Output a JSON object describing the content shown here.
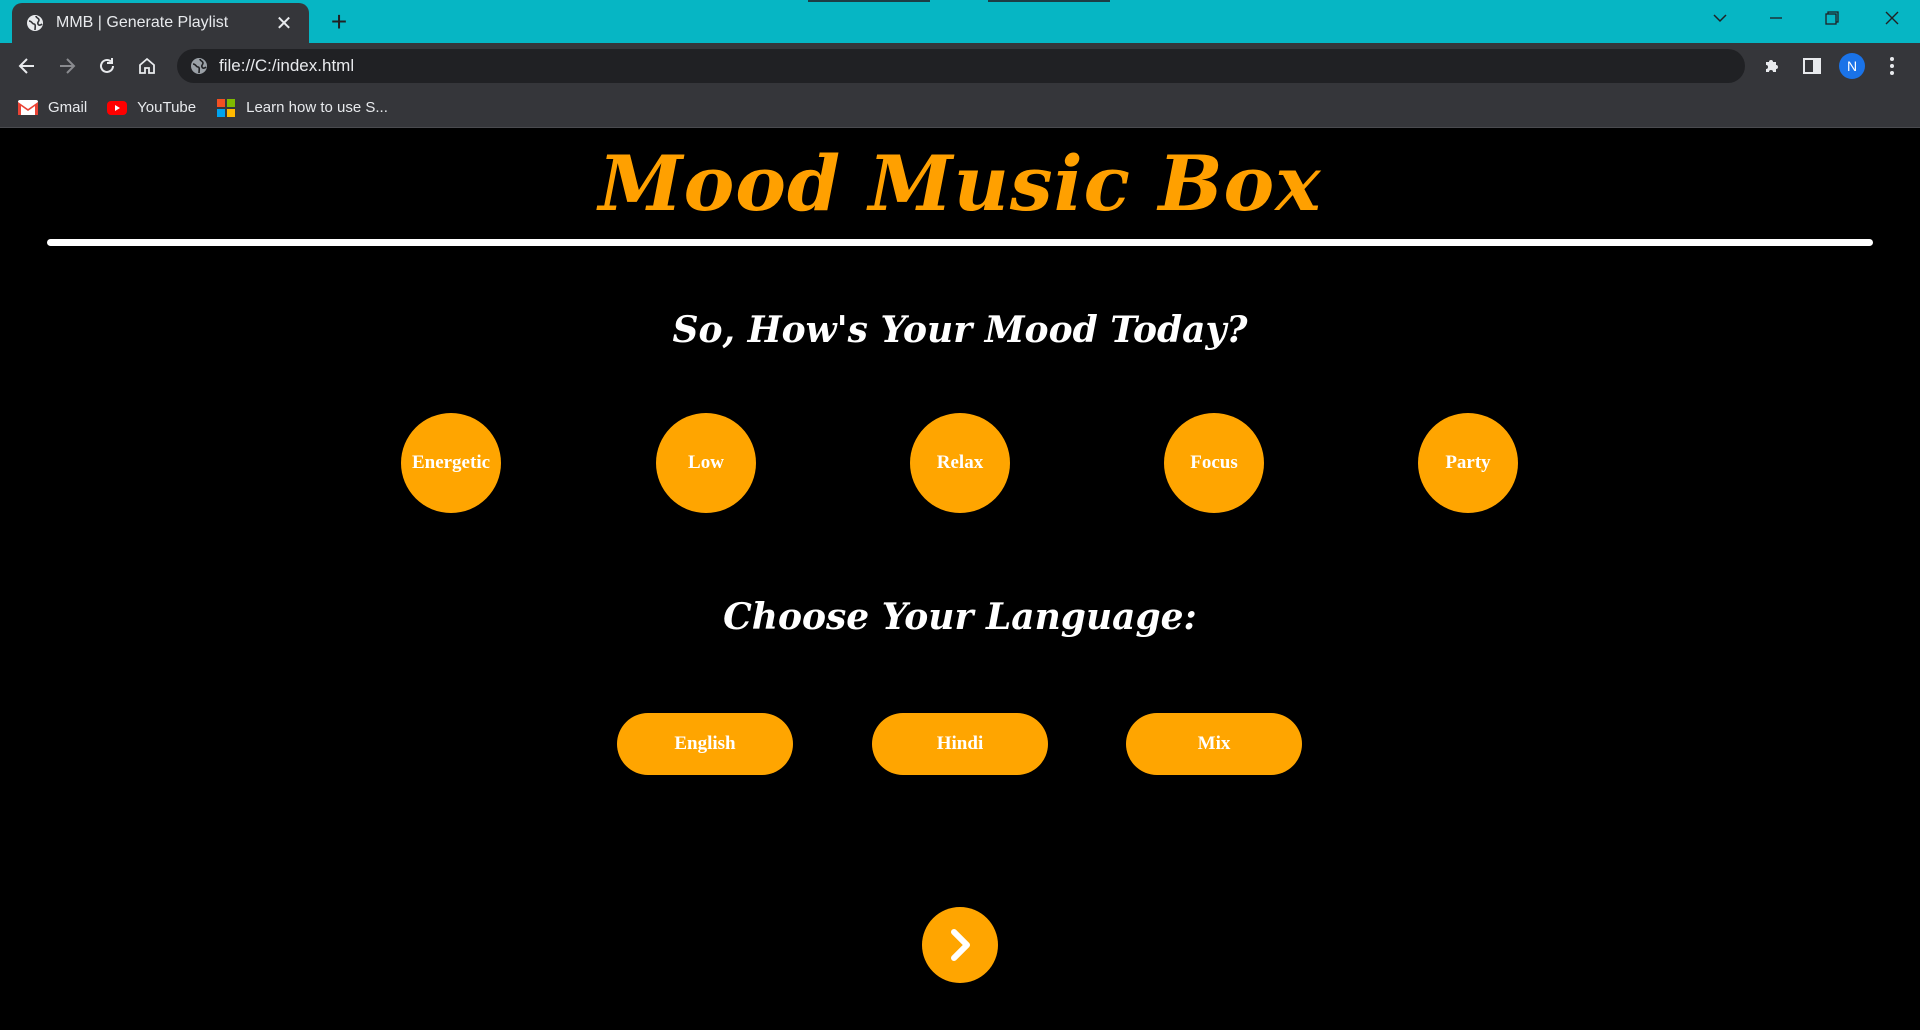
{
  "browser": {
    "tab_title": "MMB | Generate Playlist",
    "url": "file://C:/index.html",
    "profile_initial": "N",
    "bookmarks": [
      {
        "label": "Gmail",
        "icon": "gmail-icon"
      },
      {
        "label": "YouTube",
        "icon": "youtube-icon"
      },
      {
        "label": "Learn how to use S...",
        "icon": "microsoft-icon"
      }
    ]
  },
  "page": {
    "brand": "Mood Music Box",
    "mood_heading": "So, How's Your Mood Today?",
    "moods": [
      "Energetic",
      "Low",
      "Relax",
      "Focus",
      "Party"
    ],
    "language_heading": "Choose Your Language:",
    "languages": [
      "English",
      "Hindi",
      "Mix"
    ],
    "next_icon": "chevron-right-icon"
  },
  "colors": {
    "accent": "#ffa500",
    "title_bar": "#06b6c4",
    "background": "#000000"
  }
}
